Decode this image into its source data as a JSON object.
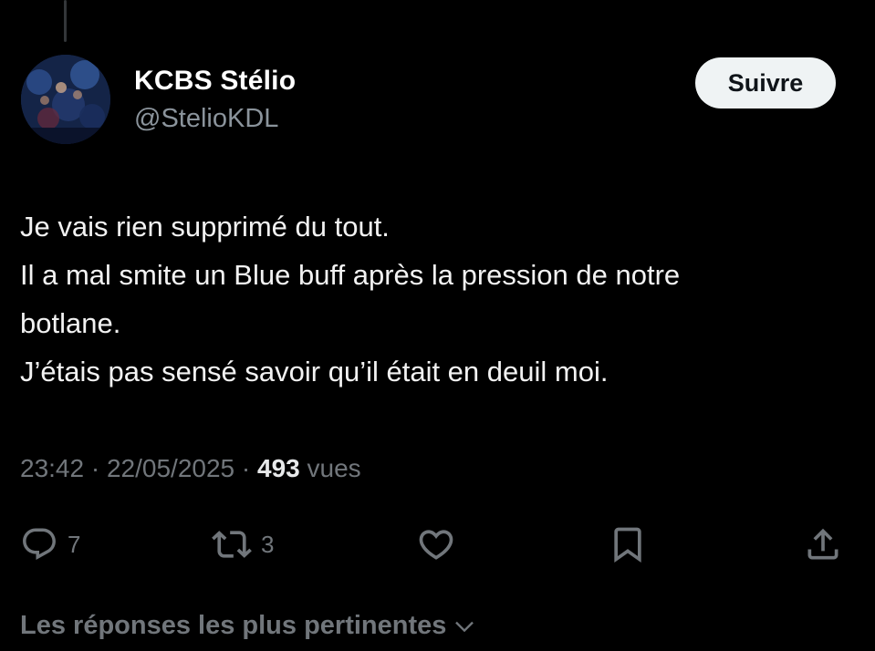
{
  "author": {
    "display_name": "KCBS Stélio",
    "handle": "@StelioKDL",
    "avatar_icon": "avatar-photo"
  },
  "follow_button": {
    "label": "Suivre"
  },
  "tweet": {
    "lines": [
      "Je vais rien supprimé du tout.",
      "Il a mal smite un Blue buff après la pression de notre",
      "botlane.",
      "J’étais pas sensé savoir qu’il était en deuil moi."
    ],
    "time": "23:42",
    "separator": "·",
    "date": "22/05/2025",
    "views_count": "493",
    "views_label": "vues"
  },
  "actions": {
    "reply": {
      "icon": "reply-icon",
      "count": "7"
    },
    "retweet": {
      "icon": "retweet-icon",
      "count": "3"
    },
    "like": {
      "icon": "heart-icon",
      "count": ""
    },
    "bookmark": {
      "icon": "bookmark-icon"
    },
    "share": {
      "icon": "share-icon"
    }
  },
  "replies_sort": {
    "label": "Les réponses les plus pertinentes",
    "icon": "chevron-down-icon"
  },
  "colors": {
    "background": "#000000",
    "primary_text": "#e7e9ea",
    "secondary_text": "#71767b",
    "follow_button_bg": "#eff3f4",
    "follow_button_text": "#0f1419"
  }
}
